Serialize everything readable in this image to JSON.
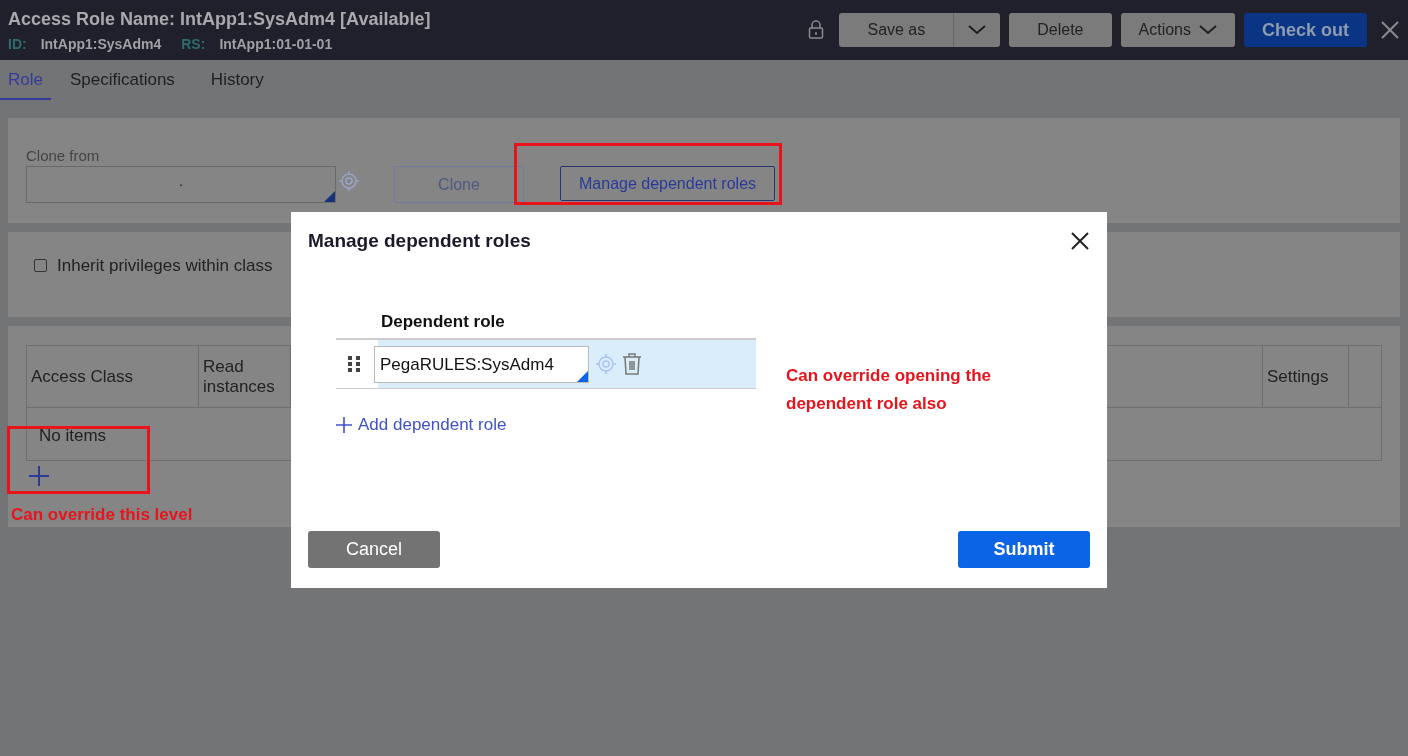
{
  "header": {
    "title": "Access Role Name: IntApp1:SysAdm4 [Available]",
    "id_label": "ID:",
    "id_value": "IntApp1:SysAdm4",
    "rs_label": "RS:",
    "rs_value": "IntApp1:01-01-01",
    "buttons": [
      {
        "kind": "split",
        "label": "Save as"
      },
      {
        "kind": "plain",
        "label": "Delete"
      },
      {
        "kind": "menu",
        "label": "Actions"
      },
      {
        "kind": "primary",
        "label": "Check out"
      }
    ]
  },
  "tabs": [
    {
      "label": "Role",
      "selected": true
    },
    {
      "label": "Specifications",
      "selected": false
    },
    {
      "label": "History",
      "selected": false
    }
  ],
  "clone_panel": {
    "label": "Clone from",
    "value": ".",
    "clone_button": {
      "label": "Clone",
      "disabled": true
    },
    "manage_button": {
      "label": "Manage dependent roles",
      "disabled": false
    }
  },
  "inherit": {
    "label": "Inherit privileges within class",
    "checked": false
  },
  "table": {
    "columns": [
      "Access Class",
      "Read instances",
      "Settings"
    ],
    "empty_text": "No items"
  },
  "modal": {
    "title": "Manage dependent roles",
    "column": "Dependent role",
    "rows": [
      {
        "value": "PegaRULES:SysAdm4"
      }
    ],
    "add_link": "Add dependent role",
    "cancel": "Cancel",
    "submit": "Submit"
  },
  "annotations": [
    {
      "text": "Can override opening the dependent role also"
    },
    {
      "text": "Can override this level"
    }
  ]
}
